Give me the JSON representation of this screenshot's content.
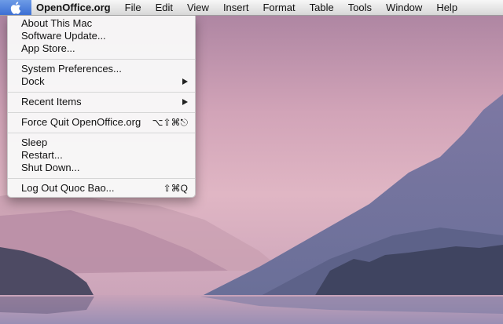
{
  "menubar": {
    "apple_icon": "apple-logo",
    "app_name": "OpenOffice.org",
    "items": [
      "File",
      "Edit",
      "View",
      "Insert",
      "Format",
      "Table",
      "Tools",
      "Window",
      "Help"
    ]
  },
  "apple_menu": {
    "items": [
      {
        "label": "About This Mac"
      },
      {
        "label": "Software Update..."
      },
      {
        "label": "App Store..."
      },
      {
        "label": "System Preferences..."
      },
      {
        "label": "Dock",
        "submenu": true
      },
      {
        "label": "Recent Items",
        "submenu": true
      },
      {
        "label": "Force Quit OpenOffice.org",
        "shortcut": "⌥⇧⌘⎋"
      },
      {
        "label": "Sleep"
      },
      {
        "label": "Restart..."
      },
      {
        "label": "Shut Down..."
      },
      {
        "label": "Log Out Quoc Bao...",
        "shortcut": "⇧⌘Q"
      }
    ]
  },
  "colors": {
    "apple_highlight": "#3c6fd4",
    "menu_bg": "#f8f8f8"
  }
}
